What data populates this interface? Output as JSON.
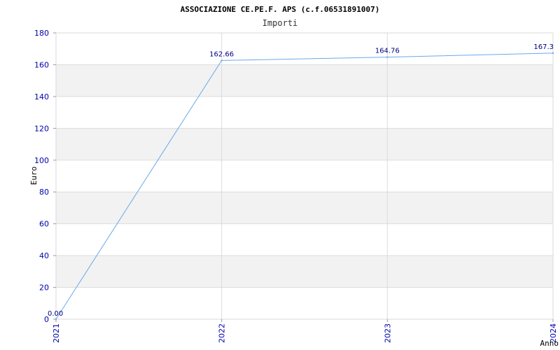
{
  "chart_data": {
    "type": "line",
    "title": "ASSOCIAZIONE CE.PE.F. APS (c.f.06531891007)",
    "subtitle": "Importi",
    "xlabel": "Anno",
    "ylabel": "Euro",
    "categories": [
      "2021",
      "2022",
      "2023",
      "2024"
    ],
    "series": [
      {
        "values": [
          0,
          162.66,
          164.76,
          167.3
        ],
        "labels": [
          "0.00",
          "162.66",
          "164.76",
          "167.3"
        ]
      }
    ],
    "ylim": [
      0,
      180
    ],
    "yticks": [
      "0",
      "20",
      "40",
      "60",
      "80",
      "100",
      "120",
      "140",
      "160",
      "180"
    ],
    "grid": true,
    "colors": {
      "line": "#6aa9e9",
      "band": "#f2f2f2",
      "tick_text": "#0000aa",
      "label_text": "#000080"
    }
  }
}
